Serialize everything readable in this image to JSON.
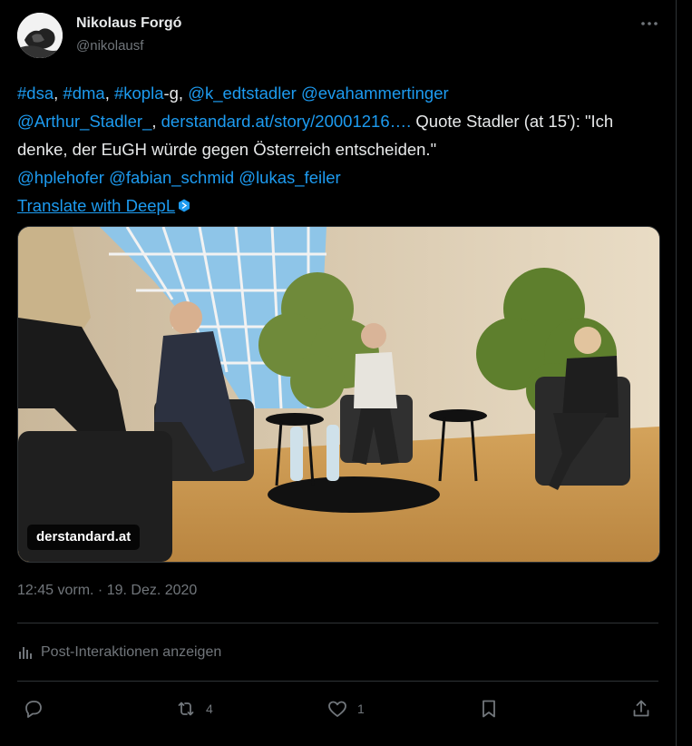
{
  "author": {
    "name": "Nikolaus Forgó",
    "handle": "@nikolausf"
  },
  "tweet": {
    "seg1_tag_dsa": "#dsa",
    "seg2": ", ",
    "seg3_tag_dma": "#dma",
    "seg4": ", ",
    "seg5_tag_kopla": "#kopla",
    "seg6": "-g, ",
    "seg7_mention": "@k_edtstadler",
    "seg8": " ",
    "seg9_mention": "@evahammertinger",
    "seg10_mention": "@Arthur_Stadler_",
    "seg11": ", ",
    "seg12_link": "derstandard.at/story/20001216….",
    "seg13": " Quote Stadler (at 15'): \"Ich denke, der EuGH würde gegen Österreich entscheiden.\"",
    "seg14_mention": "@hplehofer",
    "seg15": " ",
    "seg16_mention": "@fabian_schmid",
    "seg17": " ",
    "seg18_mention": "@lukas_feiler",
    "translate": "Translate with DeepL"
  },
  "media": {
    "source_label": "derstandard.at"
  },
  "timestamp": "12:45 vorm. · 19. Dez. 2020",
  "insights_label": "Post-Interaktionen anzeigen",
  "actions": {
    "reply_count": "",
    "repost_count": "4",
    "like_count": "1"
  },
  "colors": {
    "background": "#000000",
    "text": "#e7e9ea",
    "secondary": "#71767b",
    "link": "#1d9bf0",
    "divider": "#2f3336"
  },
  "icons": [
    "more-icon",
    "deepl-icon",
    "analytics-icon",
    "reply-icon",
    "repost-icon",
    "like-icon",
    "bookmark-icon",
    "share-icon"
  ]
}
